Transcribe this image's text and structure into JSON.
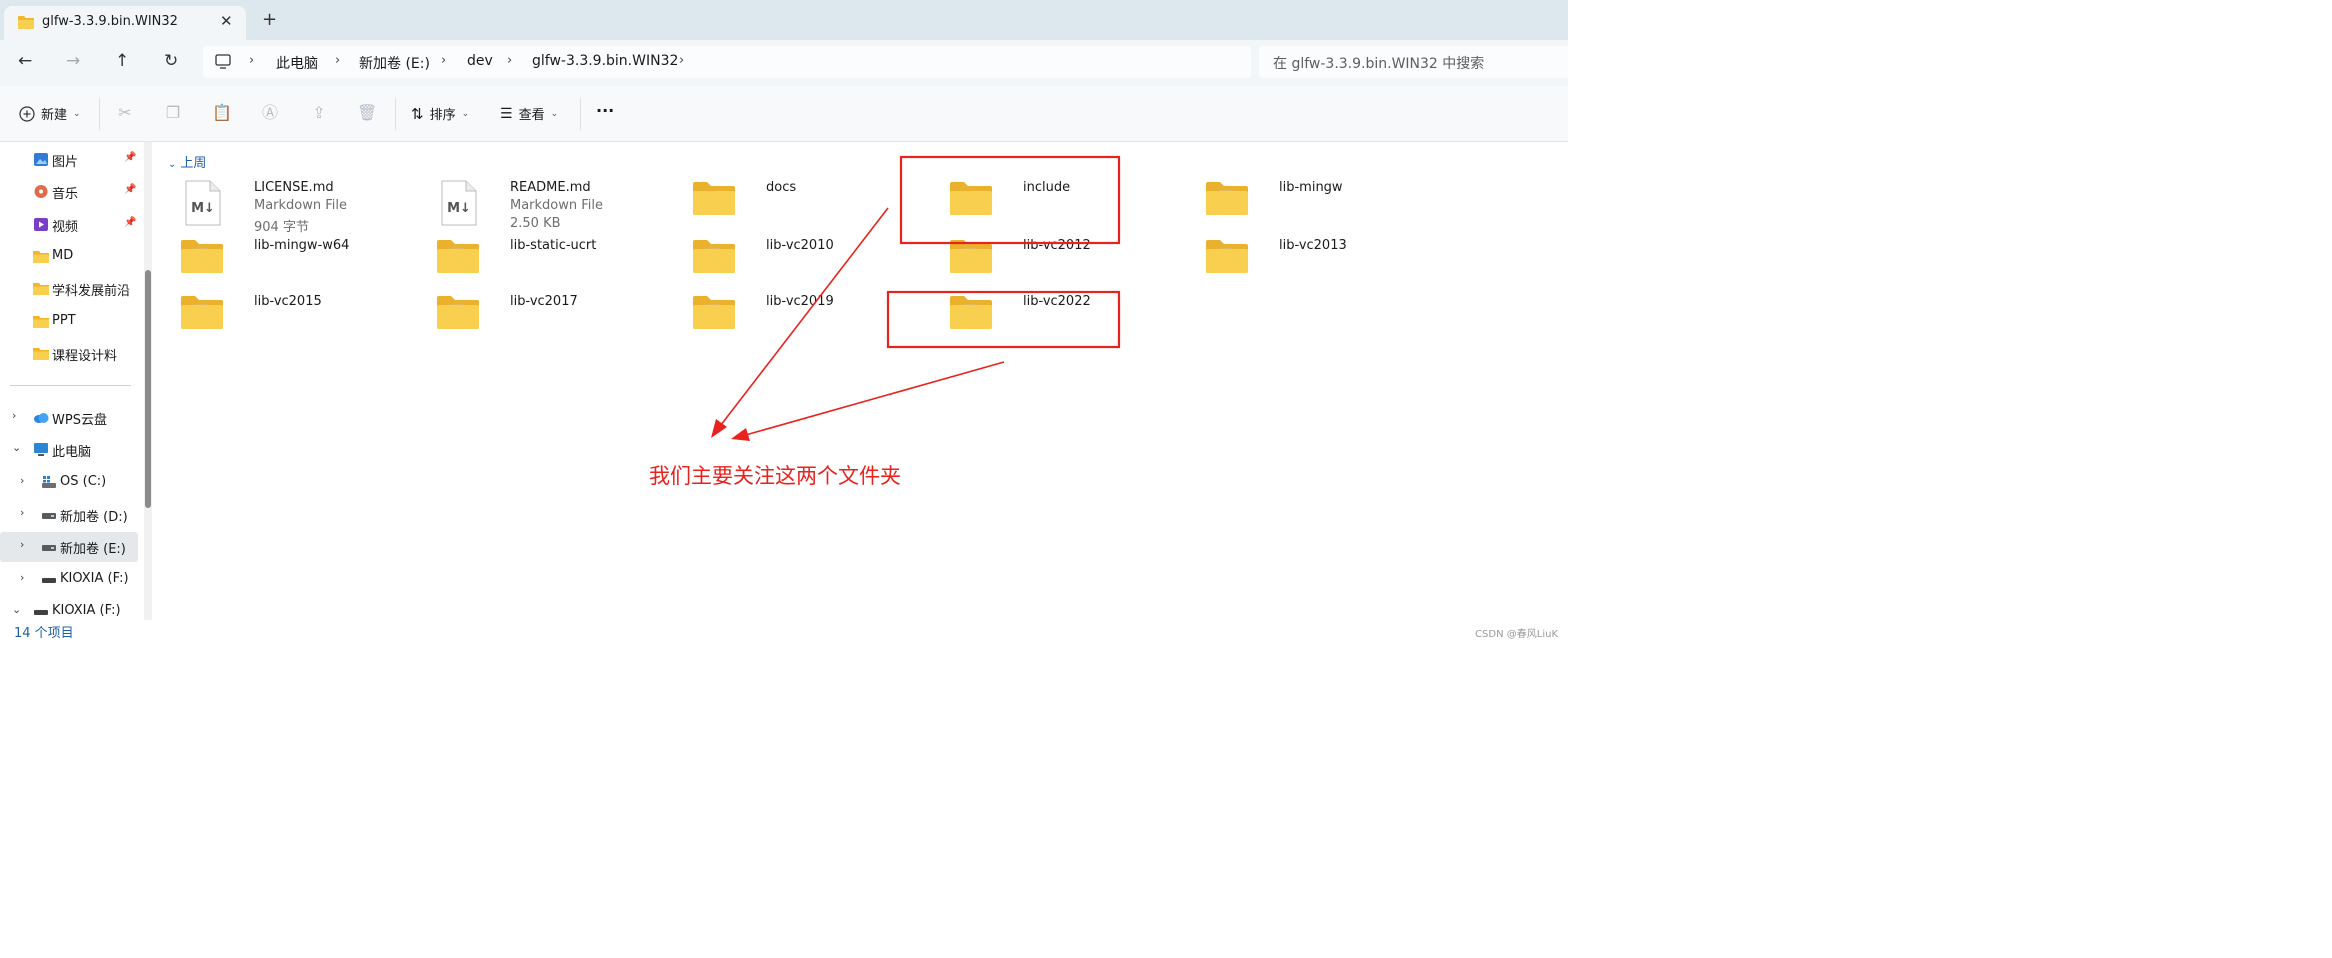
{
  "tab": {
    "title": "glfw-3.3.9.bin.WIN32",
    "close": "✕",
    "new_tab": "+"
  },
  "nav": {
    "back": "←",
    "forward": "→",
    "up": "↑",
    "refresh": "↻"
  },
  "breadcrumb": [
    "此电脑",
    "新加卷 (E:)",
    "dev",
    "glfw-3.3.9.bin.WIN32"
  ],
  "search": {
    "placeholder": "在 glfw-3.3.9.bin.WIN32 中搜索"
  },
  "toolbar": {
    "new_label": "新建",
    "sort_label": "排序",
    "view_label": "查看",
    "more": "···"
  },
  "sidebar": {
    "quick": [
      {
        "label": "图片",
        "icon": "pictures-icon",
        "pinned": true
      },
      {
        "label": "音乐",
        "icon": "music-icon",
        "pinned": true
      },
      {
        "label": "视频",
        "icon": "videos-icon",
        "pinned": true
      },
      {
        "label": "MD",
        "icon": "folder-icon",
        "pinned": false
      },
      {
        "label": "学科发展前沿",
        "icon": "folder-icon",
        "pinned": false
      },
      {
        "label": "PPT",
        "icon": "folder-icon",
        "pinned": false
      },
      {
        "label": "课程设计料",
        "icon": "folder-icon",
        "pinned": false
      }
    ],
    "tree": [
      {
        "label": "WPS云盘",
        "icon": "cloud-icon",
        "chevron": "›",
        "level": 0,
        "selected": false
      },
      {
        "label": "此电脑",
        "icon": "computer-icon",
        "chevron": "⌄",
        "level": 0,
        "selected": false
      },
      {
        "label": "OS (C:)",
        "icon": "windows-drive-icon",
        "chevron": "›",
        "level": 1,
        "selected": false
      },
      {
        "label": "新加卷 (D:)",
        "icon": "drive-icon",
        "chevron": "›",
        "level": 1,
        "selected": false
      },
      {
        "label": "新加卷 (E:)",
        "icon": "drive-icon",
        "chevron": "›",
        "level": 1,
        "selected": true
      },
      {
        "label": "KIOXIA (F:)",
        "icon": "usb-drive-icon",
        "chevron": "›",
        "level": 1,
        "selected": false
      },
      {
        "label": "KIOXIA (F:)",
        "icon": "usb-drive-icon",
        "chevron": "⌄",
        "level": 0,
        "selected": false
      }
    ]
  },
  "content": {
    "group_header": "上周",
    "items": [
      {
        "name": "LICENSE.md",
        "type": "md",
        "line2": "Markdown File",
        "line3": "904 字节"
      },
      {
        "name": "README.md",
        "type": "md",
        "line2": "Markdown File",
        "line3": "2.50 KB"
      },
      {
        "name": "docs",
        "type": "folder"
      },
      {
        "name": "include",
        "type": "folder"
      },
      {
        "name": "lib-mingw",
        "type": "folder-doc"
      },
      {
        "name": "lib-mingw-w64",
        "type": "folder-doc"
      },
      {
        "name": "lib-static-ucrt",
        "type": "folder-doc"
      },
      {
        "name": "lib-vc2010",
        "type": "folder-doc"
      },
      {
        "name": "lib-vc2012",
        "type": "folder-doc"
      },
      {
        "name": "lib-vc2013",
        "type": "folder-doc"
      },
      {
        "name": "lib-vc2015",
        "type": "folder-doc"
      },
      {
        "name": "lib-vc2017",
        "type": "folder-doc"
      },
      {
        "name": "lib-vc2019",
        "type": "folder-doc"
      },
      {
        "name": "lib-vc2022",
        "type": "folder-doc"
      }
    ]
  },
  "annotation": {
    "text": "我们主要关注这两个文件夹",
    "color": "#e8221d"
  },
  "status": {
    "count": "14 个项目",
    "watermark": "CSDN @春风LiuK"
  },
  "colors": {
    "folder": "#f7c948",
    "folder_dark": "#e9b12c",
    "accent": "#1f5fa8"
  }
}
